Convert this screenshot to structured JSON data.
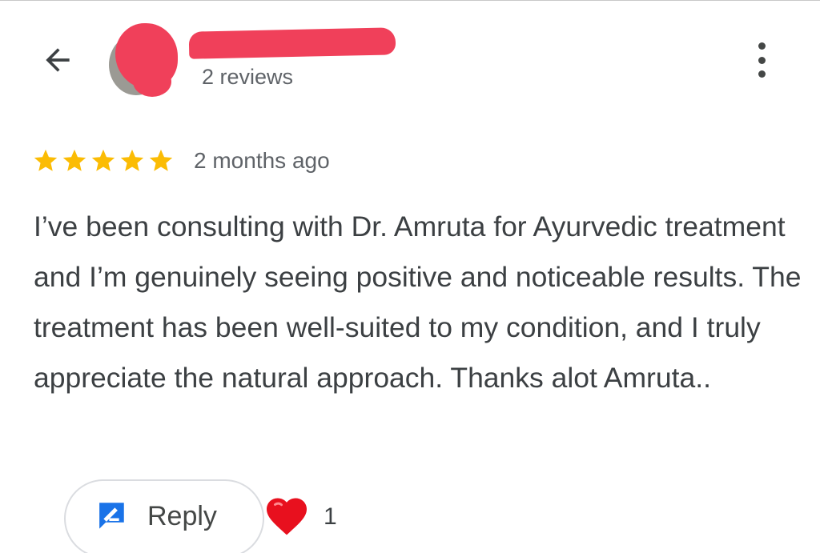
{
  "header": {
    "back_icon": "arrow-back-icon",
    "reviews_count": "2 reviews",
    "more_icon": "more-vertical-icon"
  },
  "review": {
    "rating": 5,
    "rating_max": 5,
    "star_color": "#fbbc04",
    "date": "2 months ago",
    "text": "I’ve been consulting with Dr. Amruta for Ayurvedic treatment and I’m genuinely seeing positive and noticeable results. The treatment has been well-suited to my condition, and I truly appreciate the natural approach. Thanks alot Amruta.."
  },
  "actions": {
    "reply_label": "Reply",
    "reply_icon": "reply-icon",
    "reply_icon_color": "#1a73e8",
    "reaction_icon": "heart-icon",
    "reaction_color": "#e8101e",
    "reaction_count": "1"
  },
  "redaction_color": "#f0405a"
}
